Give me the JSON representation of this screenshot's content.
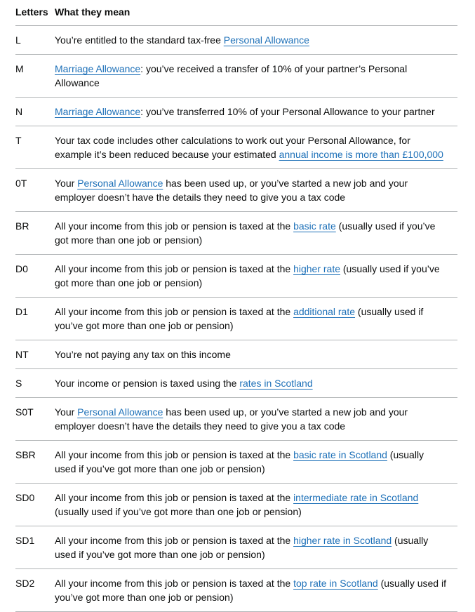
{
  "table": {
    "headers": {
      "letters": "Letters",
      "meaning": "What they mean"
    },
    "rows": [
      {
        "code": "L",
        "before": "You’re entitled to the standard tax-free ",
        "link": "Personal Allowance",
        "after": ""
      },
      {
        "code": "M",
        "before": "",
        "link": "Marriage Allowance",
        "after": ": you’ve received a transfer of 10% of your partner’s Personal Allowance"
      },
      {
        "code": "N",
        "before": "",
        "link": "Marriage Allowance",
        "after": ": you’ve transferred 10% of your Personal Allowance to your partner"
      },
      {
        "code": "T",
        "before": "Your tax code includes other calculations to work out your Personal Allowance, for example it’s been reduced because your estimated ",
        "link": "annual income is more than £100,000",
        "after": ""
      },
      {
        "code": "0T",
        "before": "Your ",
        "link": "Personal Allowance",
        "after": " has been used up, or you’ve started a new job and your employer doesn’t have the details they need to give you a tax code"
      },
      {
        "code": "BR",
        "before": "All your income from this job or pension is taxed at the ",
        "link": "basic rate",
        "after": " (usually used if you’ve got more than one job or pension)"
      },
      {
        "code": "D0",
        "before": "All your income from this job or pension is taxed at the ",
        "link": "higher rate",
        "after": " (usually used if you’ve got more than one job or pension)"
      },
      {
        "code": "D1",
        "before": "All your income from this job or pension is taxed at the ",
        "link": "additional rate",
        "after": " (usually used if you’ve got more than one job or pension)"
      },
      {
        "code": "NT",
        "before": "You’re not paying any tax on this income",
        "link": "",
        "after": ""
      },
      {
        "code": "S",
        "before": "Your income or pension is taxed using the ",
        "link": "rates in Scotland",
        "after": ""
      },
      {
        "code": "S0T",
        "before": "Your ",
        "link": "Personal Allowance",
        "after": " has been used up, or you’ve started a new job and your employer doesn’t have the details they need to give you a tax code"
      },
      {
        "code": "SBR",
        "before": "All your income from this job or pension is taxed at the ",
        "link": "basic rate in Scotland",
        "after": " (usually used if you’ve got more than one job or pension)"
      },
      {
        "code": "SD0",
        "before": "All your income from this job or pension is taxed at the ",
        "link": "intermediate rate in Scotland",
        "after": " (usually used if you’ve got more than one job or pension)"
      },
      {
        "code": "SD1",
        "before": "All your income from this job or pension is taxed at the ",
        "link": "higher rate in Scotland",
        "after": " (usually used if you’ve got more than one job or pension)"
      },
      {
        "code": "SD2",
        "before": "All your income from this job or pension is taxed at the ",
        "link": "top rate in Scotland",
        "after": " (usually used if you’ve got more than one job or pension)"
      }
    ]
  },
  "colors": {
    "text": "#0b0c0c",
    "link": "#1d70b8",
    "divider": "#b1b4b6"
  }
}
